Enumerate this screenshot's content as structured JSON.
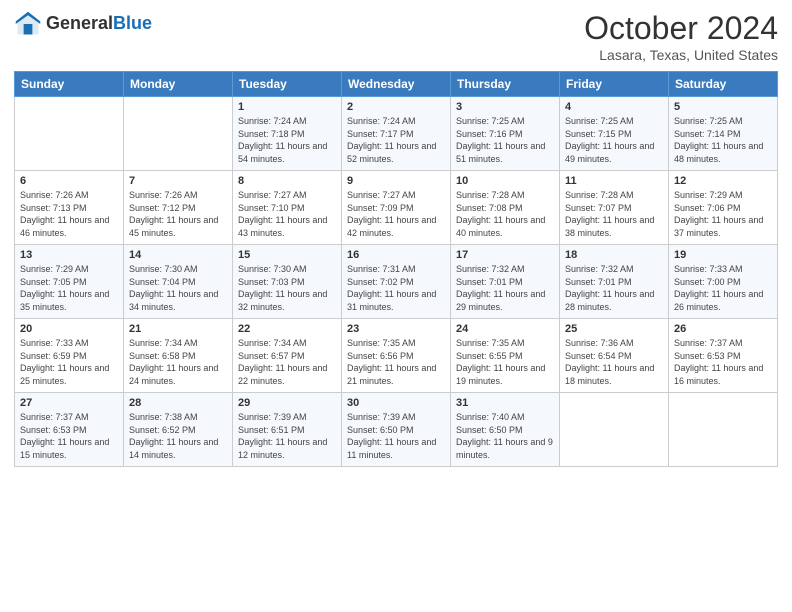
{
  "header": {
    "logo_general": "General",
    "logo_blue": "Blue",
    "month_title": "October 2024",
    "location": "Lasara, Texas, United States"
  },
  "days_of_week": [
    "Sunday",
    "Monday",
    "Tuesday",
    "Wednesday",
    "Thursday",
    "Friday",
    "Saturday"
  ],
  "weeks": [
    [
      {
        "day": "",
        "sunrise": "",
        "sunset": "",
        "daylight": ""
      },
      {
        "day": "",
        "sunrise": "",
        "sunset": "",
        "daylight": ""
      },
      {
        "day": "1",
        "sunrise": "Sunrise: 7:24 AM",
        "sunset": "Sunset: 7:18 PM",
        "daylight": "Daylight: 11 hours and 54 minutes."
      },
      {
        "day": "2",
        "sunrise": "Sunrise: 7:24 AM",
        "sunset": "Sunset: 7:17 PM",
        "daylight": "Daylight: 11 hours and 52 minutes."
      },
      {
        "day": "3",
        "sunrise": "Sunrise: 7:25 AM",
        "sunset": "Sunset: 7:16 PM",
        "daylight": "Daylight: 11 hours and 51 minutes."
      },
      {
        "day": "4",
        "sunrise": "Sunrise: 7:25 AM",
        "sunset": "Sunset: 7:15 PM",
        "daylight": "Daylight: 11 hours and 49 minutes."
      },
      {
        "day": "5",
        "sunrise": "Sunrise: 7:25 AM",
        "sunset": "Sunset: 7:14 PM",
        "daylight": "Daylight: 11 hours and 48 minutes."
      }
    ],
    [
      {
        "day": "6",
        "sunrise": "Sunrise: 7:26 AM",
        "sunset": "Sunset: 7:13 PM",
        "daylight": "Daylight: 11 hours and 46 minutes."
      },
      {
        "day": "7",
        "sunrise": "Sunrise: 7:26 AM",
        "sunset": "Sunset: 7:12 PM",
        "daylight": "Daylight: 11 hours and 45 minutes."
      },
      {
        "day": "8",
        "sunrise": "Sunrise: 7:27 AM",
        "sunset": "Sunset: 7:10 PM",
        "daylight": "Daylight: 11 hours and 43 minutes."
      },
      {
        "day": "9",
        "sunrise": "Sunrise: 7:27 AM",
        "sunset": "Sunset: 7:09 PM",
        "daylight": "Daylight: 11 hours and 42 minutes."
      },
      {
        "day": "10",
        "sunrise": "Sunrise: 7:28 AM",
        "sunset": "Sunset: 7:08 PM",
        "daylight": "Daylight: 11 hours and 40 minutes."
      },
      {
        "day": "11",
        "sunrise": "Sunrise: 7:28 AM",
        "sunset": "Sunset: 7:07 PM",
        "daylight": "Daylight: 11 hours and 38 minutes."
      },
      {
        "day": "12",
        "sunrise": "Sunrise: 7:29 AM",
        "sunset": "Sunset: 7:06 PM",
        "daylight": "Daylight: 11 hours and 37 minutes."
      }
    ],
    [
      {
        "day": "13",
        "sunrise": "Sunrise: 7:29 AM",
        "sunset": "Sunset: 7:05 PM",
        "daylight": "Daylight: 11 hours and 35 minutes."
      },
      {
        "day": "14",
        "sunrise": "Sunrise: 7:30 AM",
        "sunset": "Sunset: 7:04 PM",
        "daylight": "Daylight: 11 hours and 34 minutes."
      },
      {
        "day": "15",
        "sunrise": "Sunrise: 7:30 AM",
        "sunset": "Sunset: 7:03 PM",
        "daylight": "Daylight: 11 hours and 32 minutes."
      },
      {
        "day": "16",
        "sunrise": "Sunrise: 7:31 AM",
        "sunset": "Sunset: 7:02 PM",
        "daylight": "Daylight: 11 hours and 31 minutes."
      },
      {
        "day": "17",
        "sunrise": "Sunrise: 7:32 AM",
        "sunset": "Sunset: 7:01 PM",
        "daylight": "Daylight: 11 hours and 29 minutes."
      },
      {
        "day": "18",
        "sunrise": "Sunrise: 7:32 AM",
        "sunset": "Sunset: 7:01 PM",
        "daylight": "Daylight: 11 hours and 28 minutes."
      },
      {
        "day": "19",
        "sunrise": "Sunrise: 7:33 AM",
        "sunset": "Sunset: 7:00 PM",
        "daylight": "Daylight: 11 hours and 26 minutes."
      }
    ],
    [
      {
        "day": "20",
        "sunrise": "Sunrise: 7:33 AM",
        "sunset": "Sunset: 6:59 PM",
        "daylight": "Daylight: 11 hours and 25 minutes."
      },
      {
        "day": "21",
        "sunrise": "Sunrise: 7:34 AM",
        "sunset": "Sunset: 6:58 PM",
        "daylight": "Daylight: 11 hours and 24 minutes."
      },
      {
        "day": "22",
        "sunrise": "Sunrise: 7:34 AM",
        "sunset": "Sunset: 6:57 PM",
        "daylight": "Daylight: 11 hours and 22 minutes."
      },
      {
        "day": "23",
        "sunrise": "Sunrise: 7:35 AM",
        "sunset": "Sunset: 6:56 PM",
        "daylight": "Daylight: 11 hours and 21 minutes."
      },
      {
        "day": "24",
        "sunrise": "Sunrise: 7:35 AM",
        "sunset": "Sunset: 6:55 PM",
        "daylight": "Daylight: 11 hours and 19 minutes."
      },
      {
        "day": "25",
        "sunrise": "Sunrise: 7:36 AM",
        "sunset": "Sunset: 6:54 PM",
        "daylight": "Daylight: 11 hours and 18 minutes."
      },
      {
        "day": "26",
        "sunrise": "Sunrise: 7:37 AM",
        "sunset": "Sunset: 6:53 PM",
        "daylight": "Daylight: 11 hours and 16 minutes."
      }
    ],
    [
      {
        "day": "27",
        "sunrise": "Sunrise: 7:37 AM",
        "sunset": "Sunset: 6:53 PM",
        "daylight": "Daylight: 11 hours and 15 minutes."
      },
      {
        "day": "28",
        "sunrise": "Sunrise: 7:38 AM",
        "sunset": "Sunset: 6:52 PM",
        "daylight": "Daylight: 11 hours and 14 minutes."
      },
      {
        "day": "29",
        "sunrise": "Sunrise: 7:39 AM",
        "sunset": "Sunset: 6:51 PM",
        "daylight": "Daylight: 11 hours and 12 minutes."
      },
      {
        "day": "30",
        "sunrise": "Sunrise: 7:39 AM",
        "sunset": "Sunset: 6:50 PM",
        "daylight": "Daylight: 11 hours and 11 minutes."
      },
      {
        "day": "31",
        "sunrise": "Sunrise: 7:40 AM",
        "sunset": "Sunset: 6:50 PM",
        "daylight": "Daylight: 11 hours and 9 minutes."
      },
      {
        "day": "",
        "sunrise": "",
        "sunset": "",
        "daylight": ""
      },
      {
        "day": "",
        "sunrise": "",
        "sunset": "",
        "daylight": ""
      }
    ]
  ]
}
